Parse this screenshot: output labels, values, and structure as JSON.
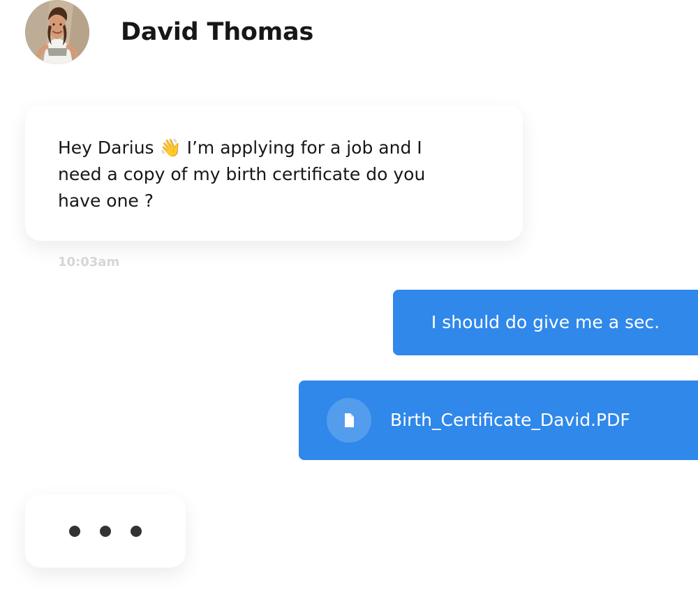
{
  "contact": {
    "name": "David Thomas",
    "avatar_icon": "profile-photo"
  },
  "messages": [
    {
      "sender": "contact",
      "text": "Hey Darius 👋 I’m applying for a job and I need a copy of my birth certificate do you have one ?",
      "time": "10:03am"
    },
    {
      "sender": "user",
      "text": "I should do give me a sec."
    },
    {
      "sender": "user",
      "type": "file",
      "icon": "document-icon",
      "filename": "Birth_Certificate_David.PDF"
    }
  ],
  "typing_indicator": {
    "icon": "typing-dots",
    "dot_count": 3
  },
  "colors": {
    "outgoing_bubble": "#2f88ea",
    "incoming_bubble": "#ffffff",
    "timestamp": "#d6d6d6",
    "text": "#171717"
  }
}
